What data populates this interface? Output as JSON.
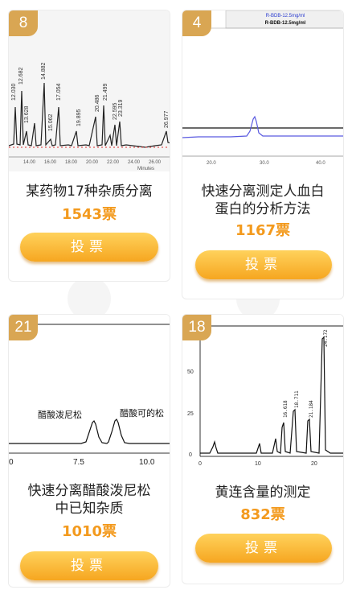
{
  "cards": [
    {
      "rank": "8",
      "title_lines": [
        "某药物17种杂质分离"
      ],
      "votes": "1543票",
      "button": "投票",
      "thumbnail": {
        "peak_labels": [
          "12.030",
          "12.682",
          "13.628",
          "14.882",
          "15.062",
          "17.054",
          "19.895",
          "20.486",
          "21.499",
          "22.595",
          "23.319",
          "26.977"
        ],
        "axis_ticks": [
          "14.00",
          "16.00",
          "18.00",
          "20.00",
          "22.00",
          "24.00",
          "26.00"
        ],
        "axis_unit": "Minutes"
      }
    },
    {
      "rank": "4",
      "title_lines": [
        "快速分离测定人血白",
        "蛋白的分析方法"
      ],
      "votes": "1167票",
      "button": "投票",
      "thumbnail": {
        "legend": [
          "R-BDB-12.5mg/ml",
          "R-BDB-12.5mg/ml"
        ],
        "axis_ticks": [
          "20.0",
          "30.0",
          "40.0"
        ]
      }
    },
    {
      "rank": "21",
      "title_lines": [
        "快速分离醋酸泼尼松",
        "中已知杂质"
      ],
      "votes": "1010票",
      "button": "投票",
      "thumbnail": {
        "peak_labels": [
          "醋酸泼尼松",
          "醋酸可的松"
        ],
        "axis_ticks": [
          "0",
          "7.5",
          "10.0"
        ]
      }
    },
    {
      "rank": "18",
      "title_lines": [
        "黄连含量的测定"
      ],
      "votes": "832票",
      "button": "投票",
      "thumbnail": {
        "peak_labels": [
          "16.618",
          "18.711",
          "21.184",
          "24.172"
        ],
        "y_ticks": [
          "0",
          "25",
          "50"
        ],
        "x_ticks": [
          "0",
          "10",
          "20"
        ]
      }
    }
  ],
  "colors": {
    "badge": "#d9a653",
    "votes": "#f39a1e",
    "button_top": "#ffd25c",
    "button_bottom": "#f6a620"
  }
}
